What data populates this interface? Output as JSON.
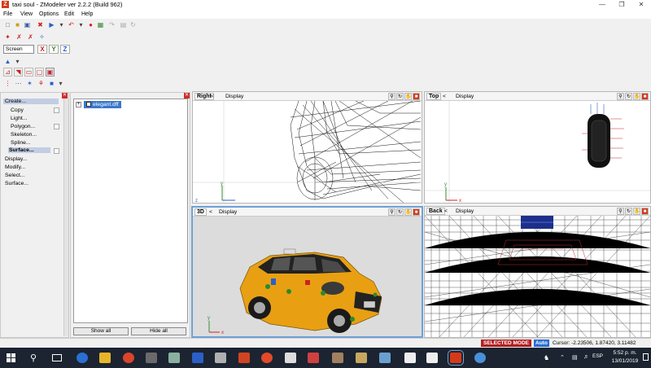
{
  "window": {
    "title": "taxi soul - ZModeler ver 2.2.2 (Build 962)",
    "app_icon": "Z"
  },
  "menu": [
    "File",
    "View",
    "Options",
    "Edit",
    "Help"
  ],
  "toolbar": {
    "coord_system": "Screen",
    "axes": [
      "X",
      "Y",
      "Z"
    ]
  },
  "commands": {
    "create": "Create...",
    "copy": "Copy",
    "light": "Light...",
    "polygon": "Polygon...",
    "skeleton": "Skeleton...",
    "spline": "Spline...",
    "surface_sub": "Surface...",
    "display": "Display...",
    "modify": "Modify...",
    "select": "Select...",
    "surface": "Surface..."
  },
  "tree": {
    "expander": "+",
    "item": "elegant.dff",
    "show_all": "Show all",
    "hide_all": "Hide all"
  },
  "viewports": {
    "right": {
      "name": "Right",
      "mode": "Display"
    },
    "top": {
      "name": "Top",
      "mode": "Display"
    },
    "three_d": {
      "name": "3D",
      "mode": "Display"
    },
    "back": {
      "name": "Back",
      "mode": "Display"
    },
    "mode_arrow": "<",
    "axis_y": "y",
    "axis_z": "z",
    "axis_x": "x"
  },
  "status": {
    "mode": "SELECTED MODE",
    "auto": "Auto",
    "cursor": "Cursor: -2.23506, 1.87420, 3.11482"
  },
  "taskbar": {
    "time": "5:52 p. m.",
    "date": "13/01/2019",
    "lang": "ESP"
  },
  "colors": {
    "car_body": "#e8a012",
    "selected_mode": "#b32020",
    "auto_badge": "#2a6fd1",
    "taskbar": "#1b2430",
    "active_viewport": "#6ea0d8"
  }
}
